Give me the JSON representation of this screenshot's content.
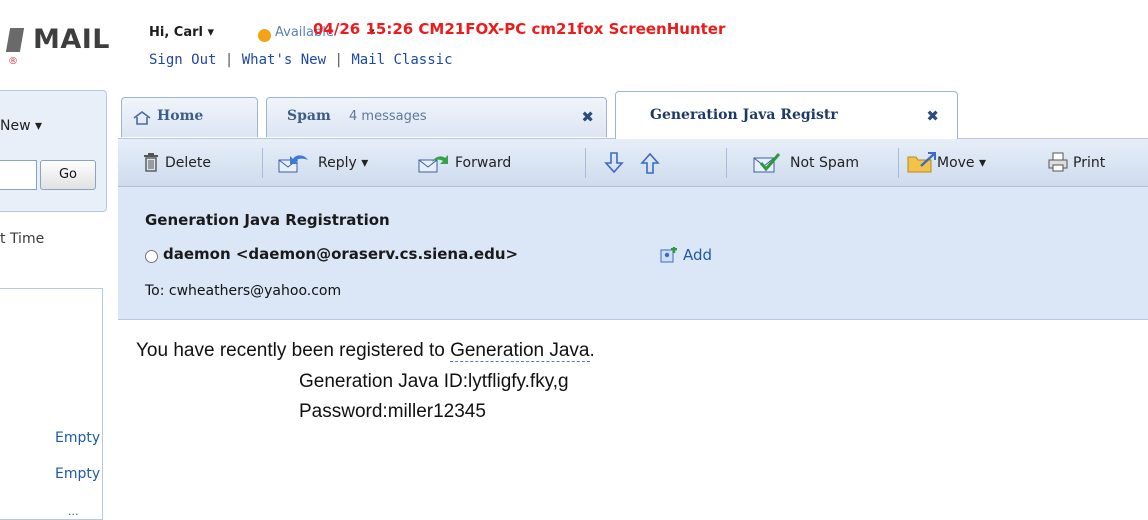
{
  "app": {
    "logo_text": "MAIL",
    "logo_reg": "®"
  },
  "user_bar": {
    "greeting": "Hi, Carl ▾",
    "presence": "Available",
    "presence_caret": "▾",
    "sign_out": "Sign Out",
    "whats_new": "What's New",
    "mail_classic": "Mail Classic",
    "separator": "|"
  },
  "watermark": "04/26 15:26  CM21FOX-PC  cm21fox  ScreenHunter",
  "left_nav": {
    "new_label": "New ▾",
    "go_label": "Go",
    "sort_label": "t Time",
    "folder_actions": [
      "Empty",
      "Empty"
    ],
    "more": "..."
  },
  "tabs": [
    {
      "label": "Home"
    },
    {
      "label": "Spam",
      "count": "4 messages",
      "close": "✖"
    },
    {
      "label": "Generation Java Registr",
      "close": "✖",
      "active": true
    }
  ],
  "toolbar": {
    "delete": "Delete",
    "reply": "Reply ▾",
    "forward": "Forward",
    "not_spam": "Not Spam",
    "move": "Move ▾",
    "print": "Print"
  },
  "message": {
    "subject": "Generation Java Registration",
    "sender": "daemon <daemon@oraserv.cs.siena.edu>",
    "add_label": "Add",
    "to": "To: cwheathers@yahoo.com",
    "body_intro": "You have recently been registered to ",
    "body_link": "Generation Java",
    "body_period": ".",
    "body_id": "Generation Java ID:lytfligfy.fky,g",
    "body_password": "Password:miller12345"
  },
  "colors": {
    "accent": "#1f49a8",
    "header_bg": "#dbe7f7",
    "toolbar_bg": "#cfdcee",
    "watermark": "#ee1b1b",
    "presence": "#f5a21b"
  }
}
